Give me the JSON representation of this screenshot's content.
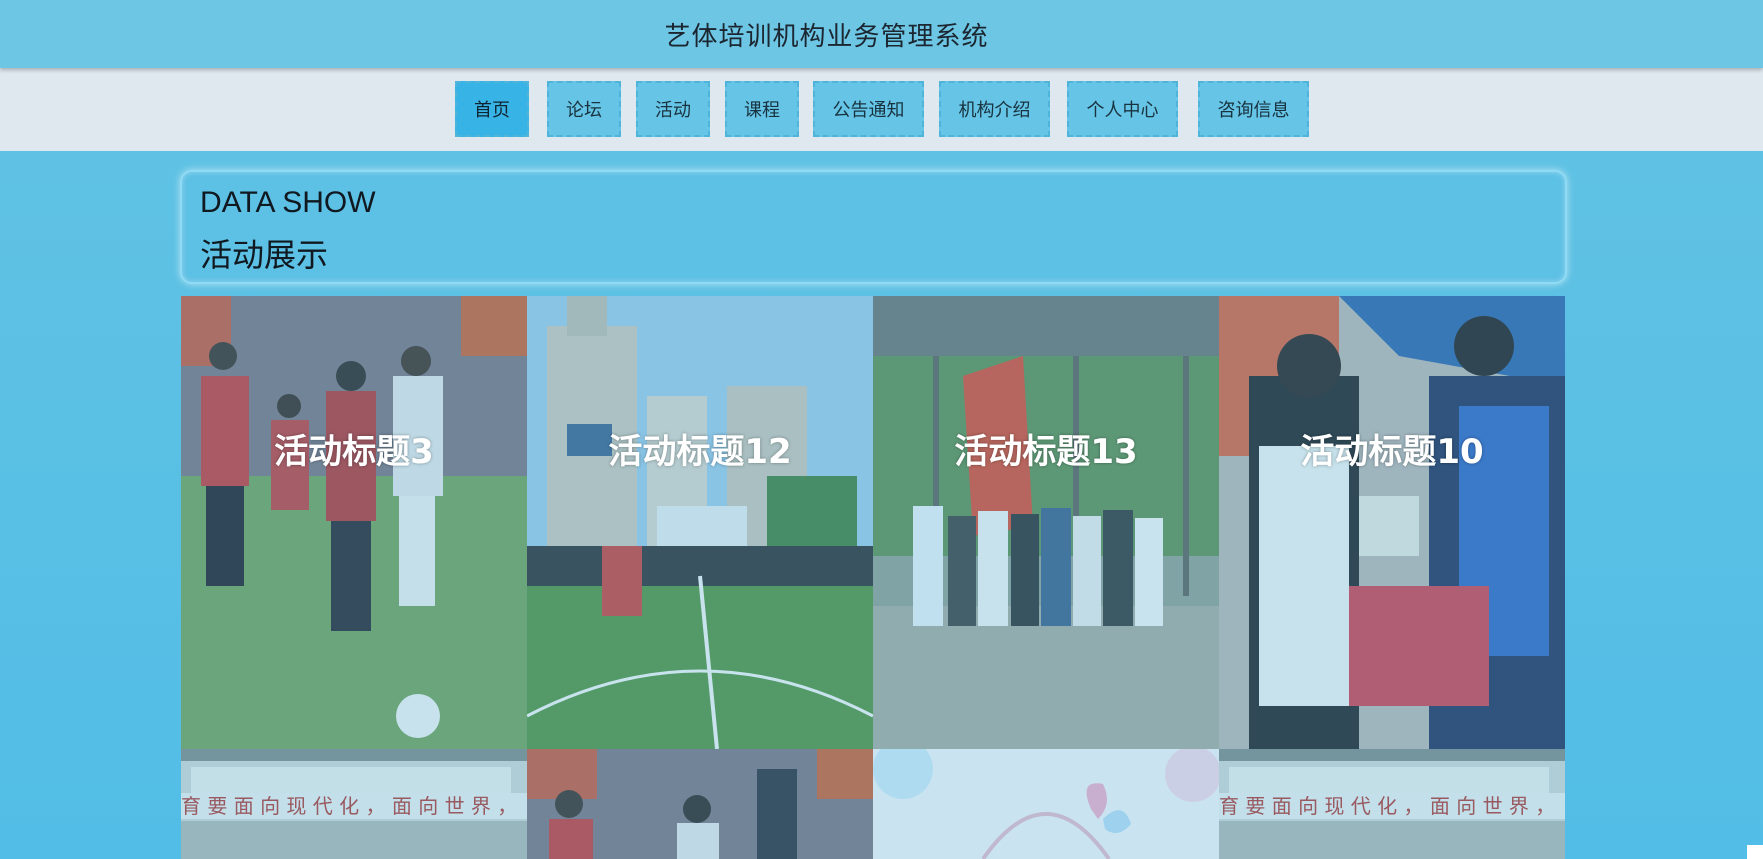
{
  "header": {
    "title": "艺体培训机构业务管理系统"
  },
  "nav": {
    "items": [
      {
        "label": "首页"
      },
      {
        "label": "论坛"
      },
      {
        "label": "活动"
      },
      {
        "label": "课程"
      },
      {
        "label": "公告通知"
      },
      {
        "label": "机构介绍"
      },
      {
        "label": "个人中心"
      },
      {
        "label": "咨询信息"
      }
    ],
    "active": "首页"
  },
  "section": {
    "title_en": "DATA SHOW",
    "title_cn": "活动展示"
  },
  "activities": [
    {
      "title": "活动标题3"
    },
    {
      "title": "活动标题12"
    },
    {
      "title": "活动标题13"
    },
    {
      "title": "活动标题10"
    }
  ],
  "colors": {
    "header_bg": "#6cc6e4",
    "nav_bg": "#dfe8ef",
    "nav_item_bg": "#66c5e6",
    "nav_active_bg": "#38b3e6",
    "page_bg": "#56bfe5"
  }
}
